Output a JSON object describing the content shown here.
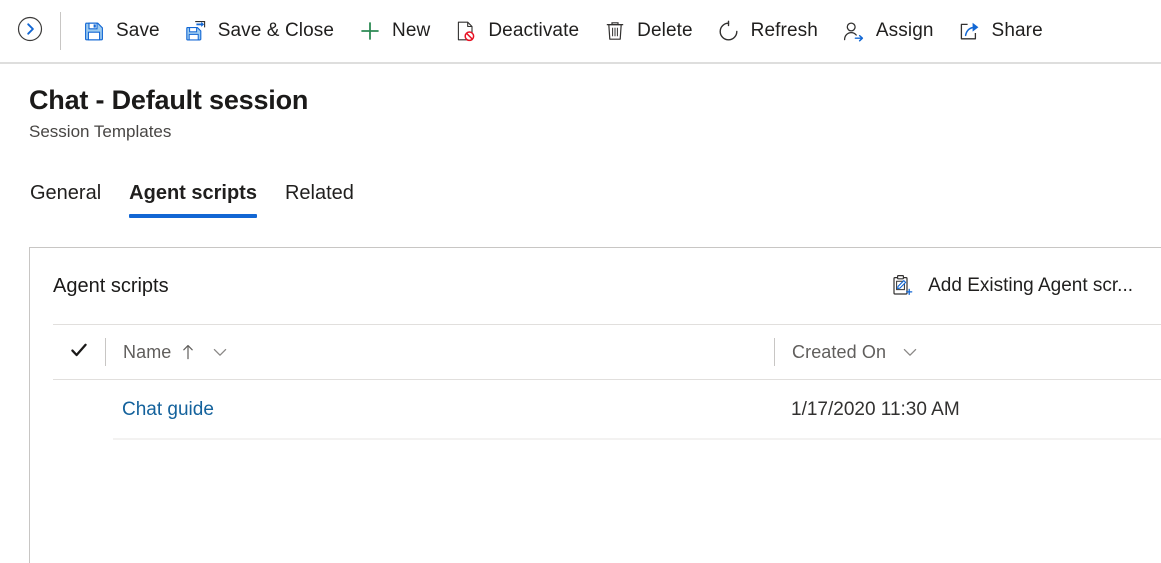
{
  "commandbar": {
    "back_icon": "chevron-right-circle-icon",
    "buttons": [
      {
        "label": "Save",
        "icon": "save-floppy-icon"
      },
      {
        "label": "Save & Close",
        "icon": "save-and-close-icon"
      },
      {
        "label": "New",
        "icon": "plus-icon"
      },
      {
        "label": "Deactivate",
        "icon": "deactivate-page-blocked-icon"
      },
      {
        "label": "Delete",
        "icon": "trash-icon"
      },
      {
        "label": "Refresh",
        "icon": "refresh-circular-arrow-icon"
      },
      {
        "label": "Assign",
        "icon": "assign-person-arrow-icon"
      },
      {
        "label": "Share",
        "icon": "share-arrow-icon"
      }
    ]
  },
  "header": {
    "title": "Chat - Default session",
    "subtitle": "Session Templates"
  },
  "tabs": [
    {
      "label": "General",
      "active": false
    },
    {
      "label": "Agent scripts",
      "active": true
    },
    {
      "label": "Related",
      "active": false
    }
  ],
  "panel": {
    "title": "Agent scripts",
    "add_existing": {
      "label": "Add Existing Agent scr...",
      "icon": "clipboard-edit-plus-icon"
    },
    "grid": {
      "select_all_icon": "checkmark-icon",
      "columns": [
        {
          "label": "Name",
          "sort": "ascending",
          "sort_icon": "arrow-up-icon",
          "menu_icon": "chevron-down-icon"
        },
        {
          "label": "Created On",
          "sort": "none",
          "menu_icon": "chevron-down-icon"
        }
      ],
      "rows": [
        {
          "name": "Chat guide",
          "created_on": "1/17/2020 11:30 AM"
        }
      ]
    }
  },
  "colors": {
    "accent": "#1267d4",
    "link": "#14629c",
    "icon_blue": "#1267d4",
    "danger": "#e81123",
    "success": "#2d8a54",
    "border": "#c8c6c4",
    "text": "#201f1e"
  }
}
